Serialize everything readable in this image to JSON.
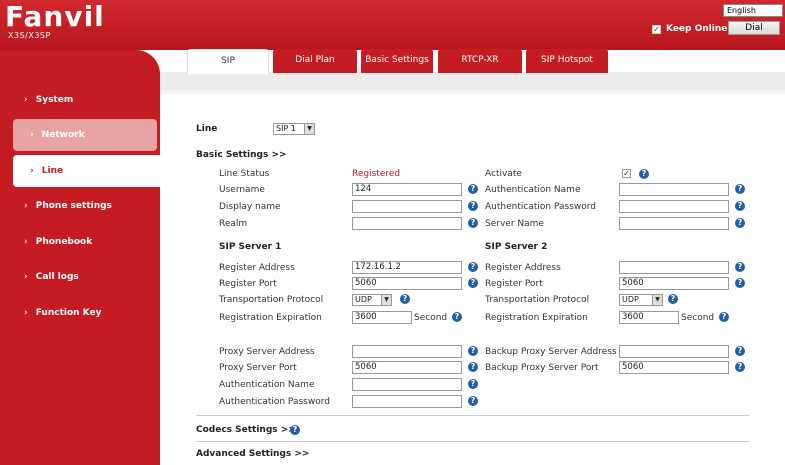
{
  "header": {
    "logo": "Fanvil",
    "model": "X3S/X3SP",
    "language": "English",
    "keep_online_label": "Keep Online",
    "dial_label": "Dial"
  },
  "sidebar": {
    "items": [
      {
        "label": "System"
      },
      {
        "label": "Network"
      },
      {
        "label": "Line"
      },
      {
        "label": "Phone settings"
      },
      {
        "label": "Phonebook"
      },
      {
        "label": "Call logs"
      },
      {
        "label": "Function Key"
      }
    ],
    "arrow": "›"
  },
  "tabs": [
    "SIP",
    "Dial Plan",
    "Basic Settings",
    "RTCP-XR",
    "SIP Hotspot"
  ],
  "line": {
    "label": "Line",
    "value": "SIP 1"
  },
  "basic": {
    "title": "Basic Settings >>",
    "line_status_label": "Line Status",
    "line_status_value": "Registered",
    "activate_label": "Activate",
    "username_label": "Username",
    "username_value": "124",
    "auth_name_label": "Authentication Name",
    "display_name_label": "Display name",
    "auth_password_label": "Authentication Password",
    "realm_label": "Realm",
    "server_name_label": "Server Name"
  },
  "server1": {
    "title": "SIP Server 1",
    "register_address_label": "Register Address",
    "register_address_value": "172.16.1.2",
    "register_port_label": "Register Port",
    "register_port_value": "5060",
    "transport_label": "Transportation Protocol",
    "transport_value": "UDP",
    "expiration_label": "Registration Expiration",
    "expiration_value": "3600",
    "expiration_unit": "Second"
  },
  "server2": {
    "title": "SIP Server 2",
    "register_address_label": "Register Address",
    "register_address_value": "",
    "register_port_label": "Register Port",
    "register_port_value": "5060",
    "transport_label": "Transportation Protocol",
    "transport_value": "UDP",
    "expiration_label": "Registration Expiration",
    "expiration_value": "3600",
    "expiration_unit": "Second"
  },
  "proxy": {
    "proxy_address_label": "Proxy Server Address",
    "proxy_port_label": "Proxy Server Port",
    "proxy_port_value": "5060",
    "auth_name_label": "Authentication Name",
    "auth_password_label": "Authentication Password",
    "backup_address_label": "Backup Proxy Server Address",
    "backup_port_label": "Backup Proxy Server Port",
    "backup_port_value": "5060"
  },
  "sections": {
    "codecs": "Codecs Settings >>",
    "advanced": "Advanced Settings >>"
  },
  "help_glyph": "?",
  "check_glyph": "✓",
  "dd_glyph": "▼"
}
